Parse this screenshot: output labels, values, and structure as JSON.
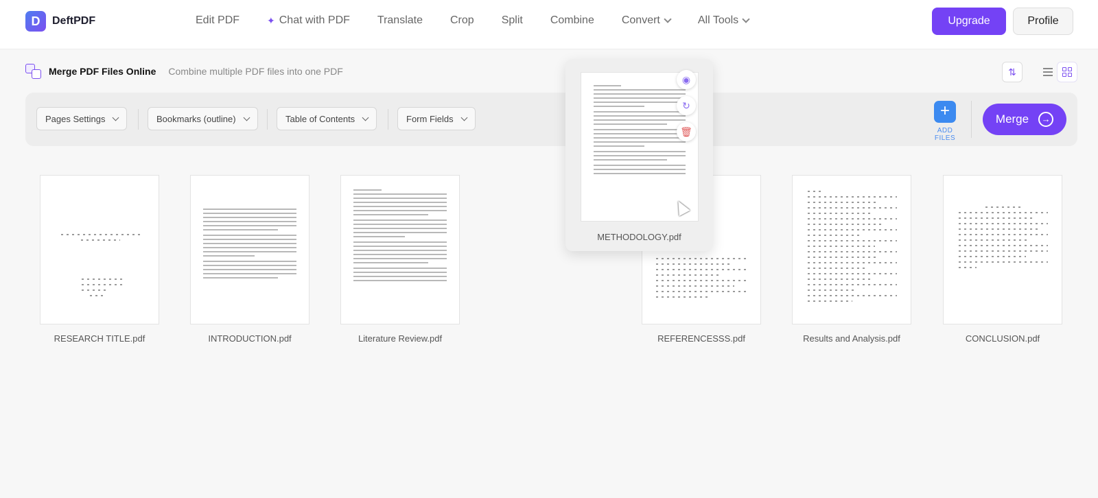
{
  "app": {
    "name": "DeftPDF",
    "logo_letter": "D"
  },
  "nav": {
    "items": [
      {
        "label": "Edit PDF"
      },
      {
        "label": "Chat with PDF",
        "icon": "sparkle-icon"
      },
      {
        "label": "Translate"
      },
      {
        "label": "Crop"
      },
      {
        "label": "Split"
      },
      {
        "label": "Combine"
      },
      {
        "label": "Convert",
        "has_dropdown": true
      },
      {
        "label": "All Tools",
        "has_dropdown": true
      }
    ],
    "upgrade_label": "Upgrade",
    "profile_label": "Profile"
  },
  "page": {
    "title": "Merge PDF Files Online",
    "subtitle": "Combine multiple PDF files into one PDF"
  },
  "toolbar": {
    "dropdowns": [
      {
        "label": "Pages Settings"
      },
      {
        "label": "Bookmarks (outline)"
      },
      {
        "label": "Table of Contents"
      },
      {
        "label": "Form Fields"
      }
    ],
    "add_files_label": "ADD FILES",
    "merge_label": "Merge"
  },
  "files": [
    {
      "name": "RESEARCH TITLE.pdf"
    },
    {
      "name": "INTRODUCTION.pdf"
    },
    {
      "name": "Literature Review.pdf"
    },
    {
      "name": "REFERENCESSS.pdf"
    },
    {
      "name": "Results and Analysis.pdf"
    },
    {
      "name": "CONCLUSION.pdf"
    }
  ],
  "dragging_file": {
    "name": "METHODOLOGY.pdf"
  },
  "colors": {
    "accent": "#7442f5",
    "add_blue": "#3c8af0",
    "delete": "#e05a5a"
  }
}
